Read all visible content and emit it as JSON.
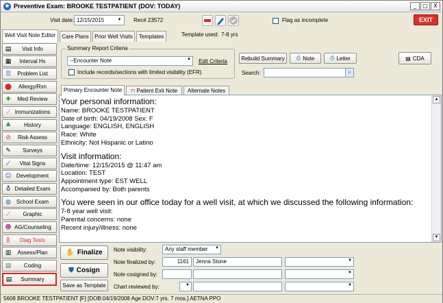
{
  "window": {
    "title": "Preventive Exam: BROOKE TESTPATIENT (DOV: TODAY)",
    "min_glyph": "_",
    "max_glyph": "□",
    "close_glyph": "X"
  },
  "toolbar": {
    "visit_date_label": "Visit date:",
    "visit_date_value": "12/15/2015",
    "rec_label": "Rec# 23572",
    "flag_incomplete_label": "Flag as incomplete",
    "exit_label": "EXIT",
    "template_used_label": "Template used:",
    "template_used_value": "7-8 yrs"
  },
  "tabs": [
    "Well Visit Note Editor",
    "Care Plans",
    "Prior Well Visits",
    "Templates"
  ],
  "sidebar": {
    "items": [
      {
        "label": "Visit Info",
        "icon": "visit-info-icon"
      },
      {
        "label": "Interval Hx",
        "icon": "interval-hx-icon"
      },
      {
        "label": "Problem List",
        "icon": "problem-list-icon"
      },
      {
        "label": "Allergy/Rxn",
        "icon": "allergy-icon"
      },
      {
        "label": "Med Review",
        "icon": "med-review-icon"
      },
      {
        "label": "Immunizations",
        "icon": "syringe-icon"
      },
      {
        "label": "History",
        "icon": "family-tree-icon"
      },
      {
        "label": "Risk Assess",
        "icon": "no-symbol-icon"
      },
      {
        "label": "Surveys",
        "icon": "survey-icon"
      },
      {
        "label": "Vital Signs",
        "icon": "vital-signs-icon"
      },
      {
        "label": "Development",
        "icon": "development-icon"
      },
      {
        "label": "Detailed Exam",
        "icon": "stethoscope-icon"
      },
      {
        "label": "School Exam",
        "icon": "globe-icon"
      },
      {
        "label": "Graphic",
        "icon": "graph-icon"
      },
      {
        "label": "AG/Counseling",
        "icon": "counseling-icon"
      },
      {
        "label": "Diag Tests",
        "icon": "test-tubes-icon"
      },
      {
        "label": "Assess/Plan",
        "icon": "assess-plan-icon"
      },
      {
        "label": "Coding",
        "icon": "coding-icon"
      },
      {
        "label": "Summary",
        "icon": "summary-icon"
      }
    ]
  },
  "criteria": {
    "legend": "Summary Report Criteria",
    "selected": "--Encounter Note",
    "edit_label": "Edit Criteria",
    "include_label": "Include records/sections with limited visibility (EFR)"
  },
  "actions": {
    "rebuild": "Rebuild Summary",
    "note": "Note",
    "letter": "Letter",
    "cda": "CDA",
    "search_label": "Search:",
    "search_value": ""
  },
  "note_tabs": [
    "Primary Encounter Note",
    "Patient Exit Note",
    "Alternate Notes"
  ],
  "note": {
    "personal_heading": "Your personal information:",
    "personal_lines": [
      "Name: BROOKE TESTPATIENT",
      "Date of birth: 04/19/2008   Sex: F",
      "Language: ENGLISH, ENGLISH",
      "Race: White",
      "Ethnicity: Not Hispanic or Latino"
    ],
    "visit_heading": "Visit information:",
    "visit_lines": [
      "Date/time: 12/15/2015 @ 11:47 am",
      "Location: TEST",
      "Appointment type: EST WELL",
      "Accompanied by: Both parents"
    ],
    "discussed_heading": "You were seen in our office today for a well visit, at which we discussed the following information:",
    "discussed_lines": [
      "7-8 year well visit:",
      "Parental concerns: none",
      "Recent injury/illness: none"
    ]
  },
  "bottom": {
    "finalize": "Finalize",
    "cosign": "Cosign",
    "save_template": "Save as Template",
    "note_visibility_label": "Note visibility:",
    "note_visibility_value": "Any staff member",
    "finalized_by_label": "Note finalized by:",
    "finalized_by_id": "1161",
    "finalized_by_name": "Jenna Stone",
    "cosigned_by_label": "Note cosigned by:",
    "chart_reviewed_label": "Chart reviewed by:"
  },
  "status": "5608 BROOKE TESTPATIENT [F] [DOB:04/19/2008  Age DOV:7 yrs. 7 mos.] AETNA PPO"
}
